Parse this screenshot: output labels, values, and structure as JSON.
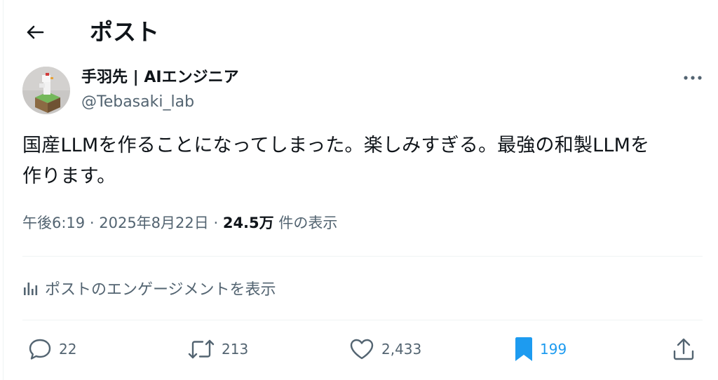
{
  "header": {
    "title": "ポスト"
  },
  "author": {
    "display_name": "手羽先 | AIエンジニア",
    "handle": "@Tebasaki_lab"
  },
  "post": {
    "text_line1": "国産LLMを作ることになってしまった。楽しみすぎる。最強の和製LLMを",
    "text_line2": "作ります。",
    "time": "午後6:19",
    "separator": "·",
    "date": "2025年8月22日",
    "views_count": "24.5万",
    "views_label": "件の表示"
  },
  "engagement_link": {
    "label": "ポストのエンゲージメントを表示"
  },
  "actions": {
    "replies": "22",
    "reposts": "213",
    "likes": "2,433",
    "bookmarks": "199"
  },
  "colors": {
    "text": "#0f1419",
    "secondary": "#536471",
    "accent": "#1d9bf0",
    "divider": "#eff3f4"
  },
  "icons": {
    "back": "arrow-left-icon",
    "more": "more-horizontal-icon",
    "reply": "speech-bubble-icon",
    "repost": "repost-arrows-icon",
    "like": "heart-icon",
    "bookmark": "bookmark-filled-icon",
    "share": "share-upload-icon",
    "analytics": "bar-chart-icon"
  }
}
